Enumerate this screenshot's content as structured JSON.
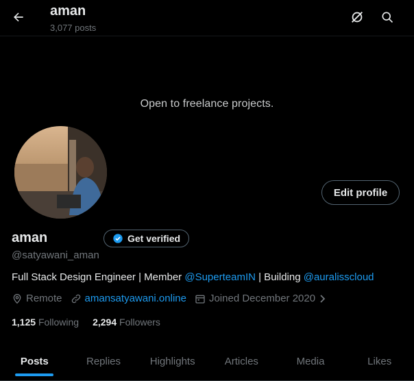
{
  "header": {
    "name": "aman",
    "posts_count": "3,077 posts",
    "back_icon": "arrow-left-icon",
    "grok_icon": "grok-icon",
    "search_icon": "search-icon"
  },
  "banner": {
    "text": "Open to freelance projects."
  },
  "profile": {
    "edit_button": "Edit profile",
    "name": "aman",
    "verify_label": "Get verified",
    "handle": "@satyawani_aman",
    "bio_prefix": "Full Stack Design Engineer | Member ",
    "bio_link1": "@SuperteamIN",
    "bio_middle": " | Building ",
    "bio_link2": "@auralisscloud",
    "location": "Remote",
    "website": "amansatyawani.online",
    "joined": "Joined December 2020",
    "following_count": "1,125",
    "following_label": "Following",
    "followers_count": "2,294",
    "followers_label": "Followers"
  },
  "tabs": [
    {
      "label": "Posts"
    },
    {
      "label": "Replies"
    },
    {
      "label": "Highlights"
    },
    {
      "label": "Articles"
    },
    {
      "label": "Media"
    },
    {
      "label": "Likes"
    }
  ],
  "colors": {
    "accent": "#1d9bf0",
    "background": "#000000",
    "muted": "#71767b"
  }
}
